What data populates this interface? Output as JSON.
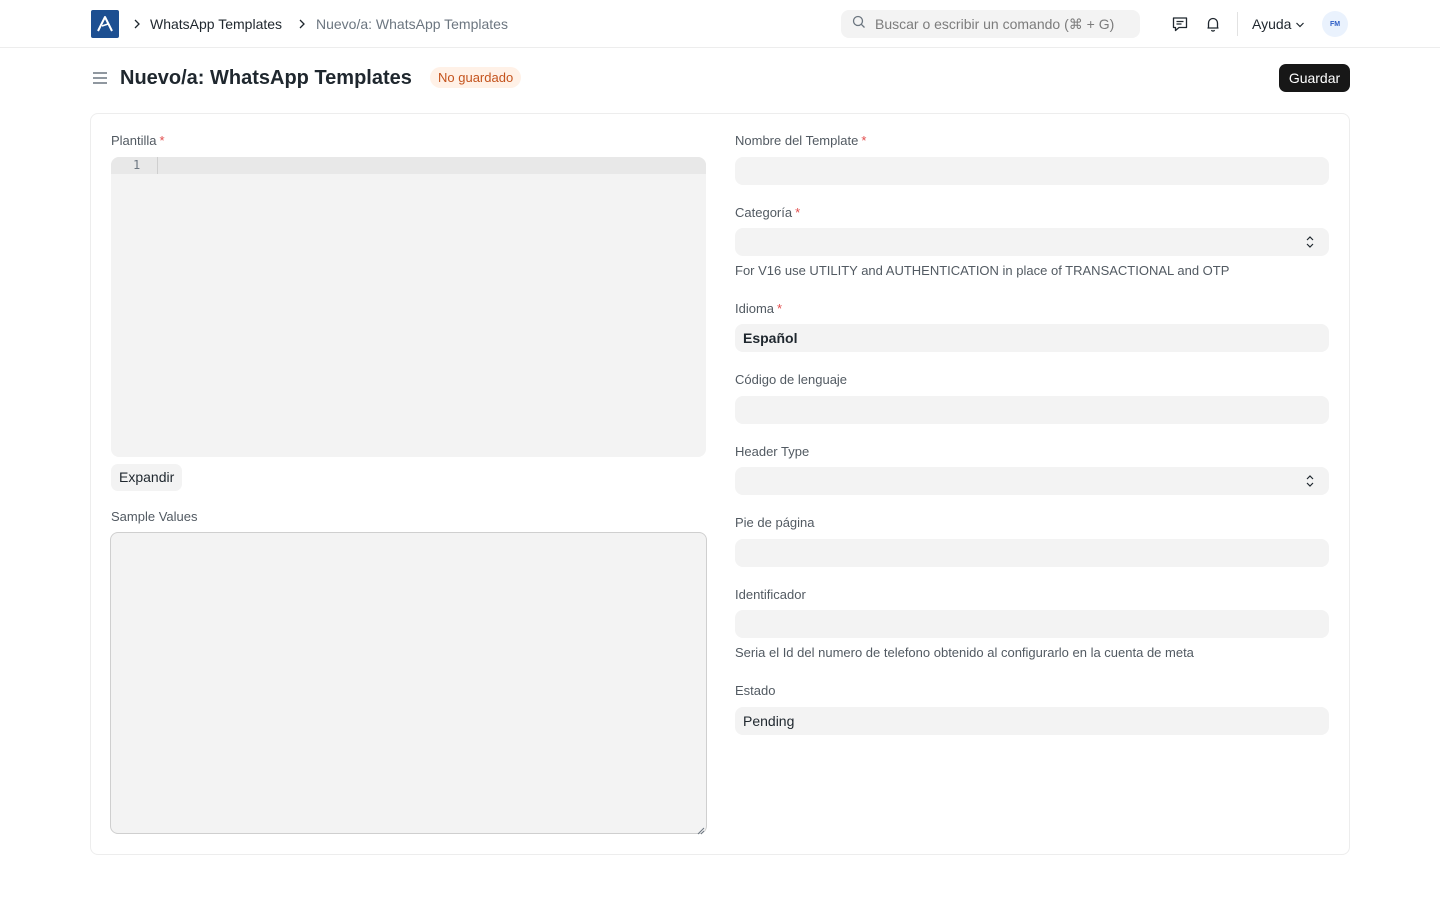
{
  "navbar": {
    "breadcrumbs": [
      "WhatsApp Templates",
      "Nuevo/a: WhatsApp Templates"
    ],
    "search_placeholder": "Buscar o escribir un comando (⌘ + G)",
    "help_label": "Ayuda",
    "avatar_initials": "FM"
  },
  "page": {
    "title": "Nuevo/a: WhatsApp Templates",
    "status": "No guardado",
    "save_label": "Guardar"
  },
  "form": {
    "left": {
      "template_label": "Plantilla",
      "code_line_number": "1",
      "expand_label": "Expandir",
      "sample_values_label": "Sample Values"
    },
    "right": {
      "template_name_label": "Nombre del Template",
      "category_label": "Categoría",
      "category_help": "For V16 use UTILITY and AUTHENTICATION in place of TRANSACTIONAL and OTP",
      "language_label": "Idioma",
      "language_value": "Español",
      "language_code_label": "Código de lenguaje",
      "header_type_label": "Header Type",
      "footer_label": "Pie de página",
      "identifier_label": "Identificador",
      "identifier_help": "Seria el Id del numero de telefono obtenido al configurarlo en la cuenta de meta",
      "status_label": "Estado",
      "status_value": "Pending"
    }
  },
  "colors": {
    "logo_bg": "#1d4f91",
    "primary_button": "#171717",
    "status_pill_bg": "#fff1e7",
    "status_pill_text": "#c4531d",
    "required_mark": "#e24c4c",
    "control_bg": "#f3f3f3"
  },
  "icons": [
    "app-logo-icon",
    "chevron-right-icon",
    "search-icon",
    "chat-icon",
    "bell-icon",
    "chevron-down-icon",
    "hamburger-icon",
    "select-arrows-icon",
    "resize-grip-icon"
  ]
}
